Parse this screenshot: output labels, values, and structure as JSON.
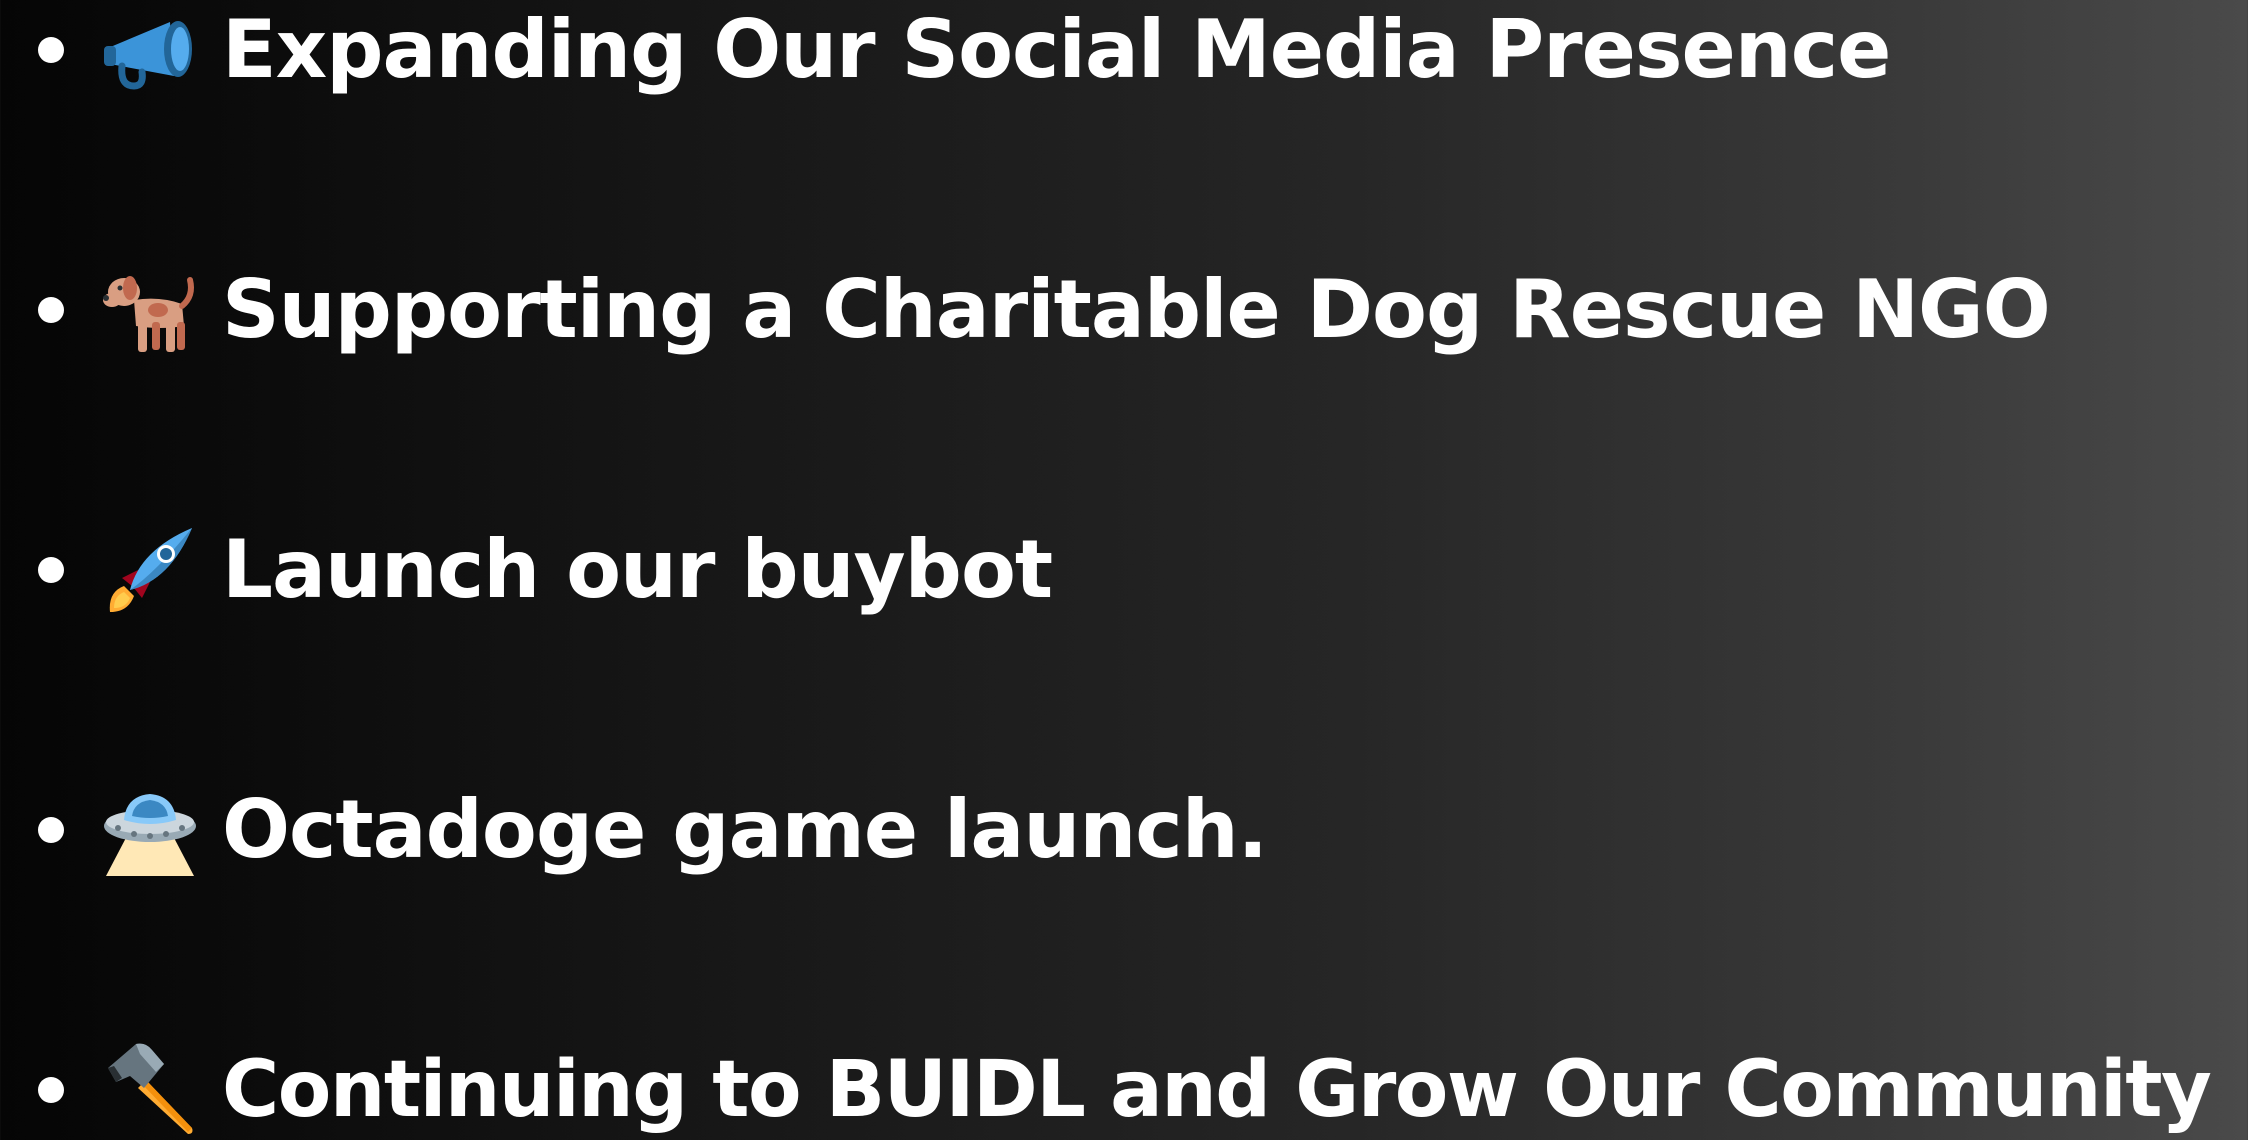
{
  "roadmap": {
    "items": [
      {
        "icon": "megaphone-icon",
        "text": "Expanding Our Social Media Presence"
      },
      {
        "icon": "dog-icon",
        "text": "Supporting a Charitable Dog Rescue NGO"
      },
      {
        "icon": "rocket-icon",
        "text": "Launch our buybot"
      },
      {
        "icon": "ufo-icon",
        "text": "Octadoge game launch."
      },
      {
        "icon": "hammer-icon",
        "text": "Continuing to BUIDL and Grow Our Community"
      }
    ]
  },
  "colors": {
    "text": "#ffffff",
    "background_left": "#050505",
    "background_right": "#4a4a4a"
  }
}
